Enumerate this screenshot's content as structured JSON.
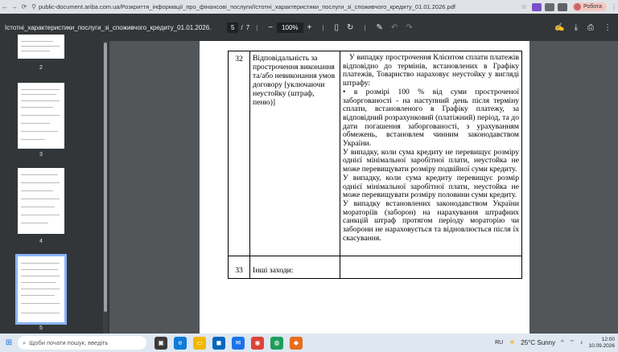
{
  "browser": {
    "url": "public-document.ariba.com.ua/Розкриття_інформації_про_фінансові_послуги/Істотні_характеристики_послуги_зі_споживчого_кредиту_01.01.2026.pdf",
    "profile_label": "Робота"
  },
  "toolbar": {
    "title": "Істотні_характеристики_послуги_зі_споживчого_кредиту_01.01.2026.pdf",
    "current_page": "5",
    "page_sep": "/",
    "total_pages": "7",
    "zoom_minus": "−",
    "zoom": "100%",
    "zoom_plus": "+"
  },
  "sidebar": {
    "thumbnails": [
      {
        "label": "2"
      },
      {
        "label": "3"
      },
      {
        "label": "4"
      },
      {
        "label": "5"
      }
    ]
  },
  "table": {
    "row32": {
      "num": "32",
      "label": "Відповідальність за прострочення виконання та/або невиконання умов договору [уключаючи неустойку (штраф, пеню)]",
      "paragraphs": [
        "У випадку прострочення Клієнтом сплати платежів відповідно до термінів, встановлених в Графіку платежів, Товариство нараховує неустойку у вигляді штрафу:",
        "•      в розмірі 100 % від суми простроченої заборгованості - на наступний день після терміну сплати, встановленого в Графіку платежу, за відповідний розрахунковий (платіжний) період, та до дати погашення заборгованості, з урахуванням обмежень, встановлем чинним законодавством України.",
        "У випадку, коли сума кредиту не перевищує розміру однієї мінімальної заробітної плати, неустойка не може перевищувати розміру подвійної суми кредиту.",
        "У випадку, коли сума кредиту перевищує розмір однієї мінімальної заробітної плати, неустойка не може перевищувати розміру половини суми кредиту.",
        "У випадку встановлених законодавством України мораторіїв (заборон) на нарахування штрафних санкцій штраф протягом періоду мораторію чи заборони не нараховується та відновлюється після їх скасування."
      ]
    },
    "row33": {
      "num": "33",
      "label": "Інші заходи:",
      "body": ""
    }
  },
  "taskbar": {
    "search_placeholder": "Щоби почати пошук, введіть",
    "lang": "RU",
    "weather": "25°C  Sunny",
    "time": "12:00",
    "date": "10.09.2026"
  },
  "colors": {
    "toolbar_bg": "#323639",
    "doc_bg": "#525659",
    "active_thumb": "#8ab4f8"
  }
}
